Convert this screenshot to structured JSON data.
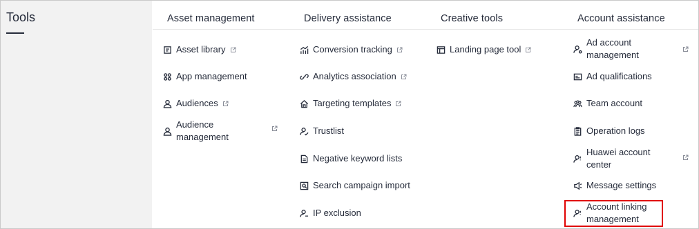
{
  "page": {
    "title": "Tools"
  },
  "columns": [
    {
      "header": "Asset management",
      "items": [
        {
          "label": "Asset library",
          "icon": "document-icon",
          "external": true
        },
        {
          "label": "App management",
          "icon": "apps-grid-icon",
          "external": false
        },
        {
          "label": "Audiences",
          "icon": "user-icon",
          "external": true
        },
        {
          "label": "Audience management",
          "icon": "user-icon",
          "external": true
        }
      ]
    },
    {
      "header": "Delivery assistance",
      "items": [
        {
          "label": "Conversion tracking",
          "icon": "chart-icon",
          "external": true
        },
        {
          "label": "Analytics association",
          "icon": "link-icon",
          "external": true
        },
        {
          "label": "Targeting templates",
          "icon": "home-icon",
          "external": true
        },
        {
          "label": "Trustlist",
          "icon": "user-check-icon",
          "external": false
        },
        {
          "label": "Negative keyword lists",
          "icon": "file-list-icon",
          "external": false
        },
        {
          "label": "Search campaign import",
          "icon": "search-doc-icon",
          "external": false
        },
        {
          "label": "IP exclusion",
          "icon": "user-exclude-icon",
          "external": false
        }
      ]
    },
    {
      "header": "Creative tools",
      "items": [
        {
          "label": "Landing page tool",
          "icon": "window-icon",
          "external": true
        }
      ]
    },
    {
      "header": "Account assistance",
      "items": [
        {
          "label": "Ad account management",
          "icon": "user-gear-icon",
          "external": true
        },
        {
          "label": "Ad qualifications",
          "icon": "id-card-icon",
          "external": false
        },
        {
          "label": "Team account",
          "icon": "team-icon",
          "external": false
        },
        {
          "label": "Operation logs",
          "icon": "clipboard-icon",
          "external": false
        },
        {
          "label": "Huawei account center",
          "icon": "user-link-icon",
          "external": true
        },
        {
          "label": "Message settings",
          "icon": "speaker-icon",
          "external": false
        },
        {
          "label": "Account linking management",
          "icon": "user-link-icon",
          "external": false
        }
      ]
    }
  ],
  "colors": {
    "text": "#252b3a",
    "sidebar_bg": "#f2f2f2",
    "highlight": "#e00000"
  }
}
